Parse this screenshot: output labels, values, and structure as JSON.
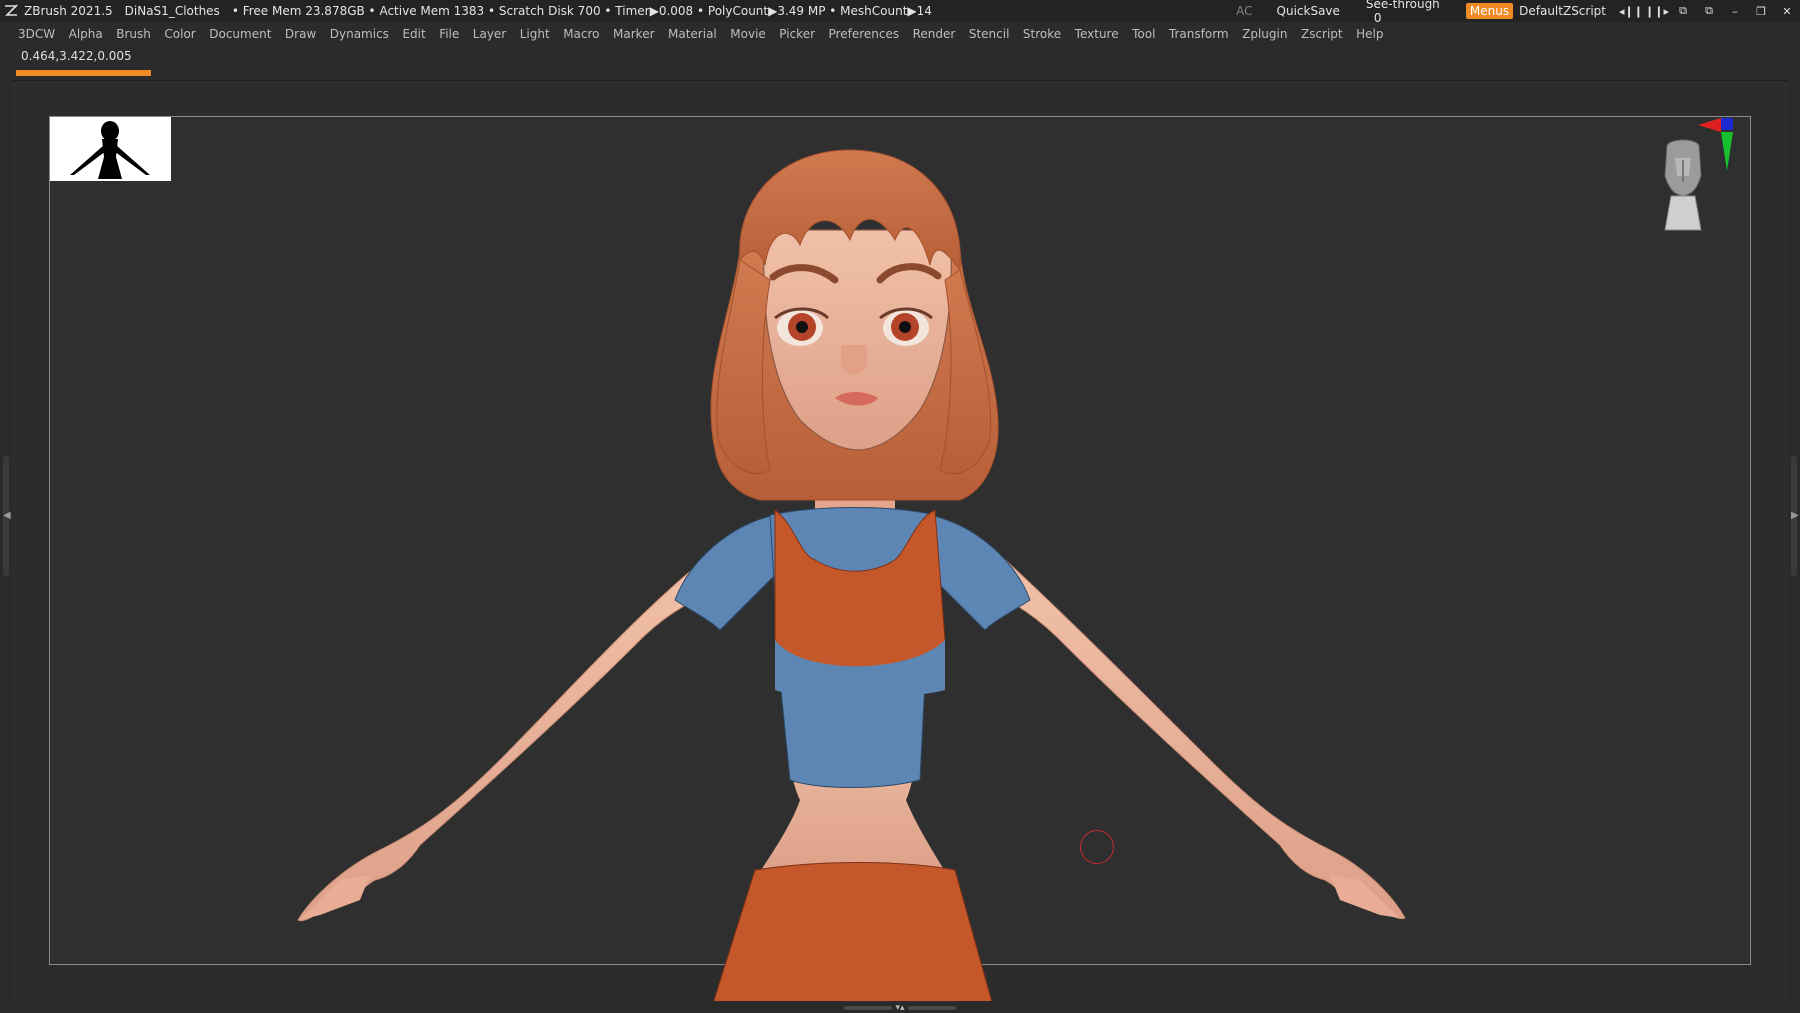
{
  "titlebar": {
    "app": "ZBrush 2021.5",
    "document": "DiNaS1_Clothes",
    "stats": "• Free Mem 23.878GB • Active Mem 1383 • Scratch Disk 700 •  Timer▶0.008 • PolyCount▶3.49 MP  • MeshCount▶14",
    "ac": "AC",
    "quicksave": "QuickSave",
    "seethrough_label": "See-through",
    "seethrough_value": "0",
    "menus": "Menus",
    "default_zscript": "DefaultZScript"
  },
  "menubar": [
    "3DCW",
    "Alpha",
    "Brush",
    "Color",
    "Document",
    "Draw",
    "Dynamics",
    "Edit",
    "File",
    "Layer",
    "Light",
    "Macro",
    "Marker",
    "Material",
    "Movie",
    "Picker",
    "Preferences",
    "Render",
    "Stencil",
    "Stroke",
    "Texture",
    "Tool",
    "Transform",
    "Zplugin",
    "Zscript",
    "Help"
  ],
  "infobar": {
    "coordinates": "0.464,3.422,0.005",
    "progress_fraction": 1.0
  },
  "colors": {
    "accent": "#f08a24",
    "canvas_bg": "#2f2f2f",
    "skin": "#e9b299",
    "hair": "#c86c44",
    "top_orange": "#c4582b",
    "shirt_blue": "#5d86b4",
    "cursor_ring": "#c92a2a"
  },
  "icons": {
    "app_logo": "zbrush-logo-icon",
    "gizmo": "axis-gizmo-icon",
    "head_nav": "head-navigator-icon"
  }
}
